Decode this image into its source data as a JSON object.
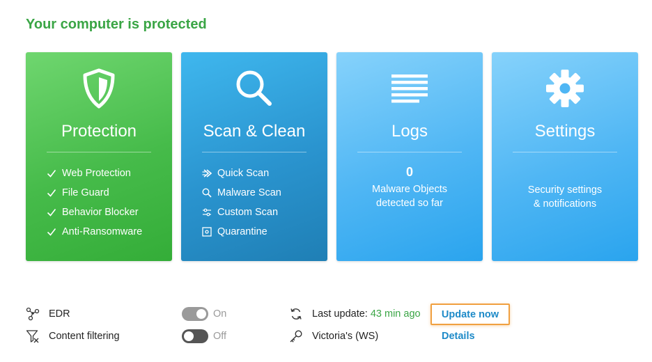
{
  "status": {
    "title": "Your computer is protected",
    "color": "#3aa545"
  },
  "tiles": {
    "protection": {
      "title": "Protection",
      "icon": "shield-icon",
      "features": [
        "Web Protection",
        "File Guard",
        "Behavior Blocker",
        "Anti-Ransomware"
      ]
    },
    "scan": {
      "title": "Scan & Clean",
      "icon": "magnifier-icon",
      "items": [
        {
          "label": "Quick Scan",
          "icon": "quick-scan-icon"
        },
        {
          "label": "Malware Scan",
          "icon": "search-icon"
        },
        {
          "label": "Custom Scan",
          "icon": "sliders-icon"
        },
        {
          "label": "Quarantine",
          "icon": "quarantine-icon"
        }
      ]
    },
    "logs": {
      "title": "Logs",
      "icon": "logs-list-icon",
      "count": "0",
      "line1": "Malware Objects",
      "line2": "detected so far"
    },
    "settings": {
      "title": "Settings",
      "icon": "gear-icon",
      "line1": "Security settings",
      "line2": "& notifications"
    }
  },
  "bottom": {
    "edr": {
      "label": "EDR",
      "icon": "network-nodes-icon",
      "toggle_state": "On"
    },
    "content_filtering": {
      "label": "Content filtering",
      "icon": "filter-icon",
      "toggle_state": "Off"
    },
    "update": {
      "label": "Last update:",
      "time_ago": "43 min ago",
      "icon": "refresh-icon",
      "button": "Update now"
    },
    "workstation": {
      "name": "Victoria's (WS)",
      "icon": "key-icon",
      "link": "Details"
    }
  },
  "colors": {
    "protection_tile": "#46bb4a",
    "scan_tile": "#2a94cf",
    "logs_tile": "#4fb6f4",
    "settings_tile": "#4fb6f4",
    "link": "#1d8ac8",
    "highlight_border": "#f0a040"
  }
}
